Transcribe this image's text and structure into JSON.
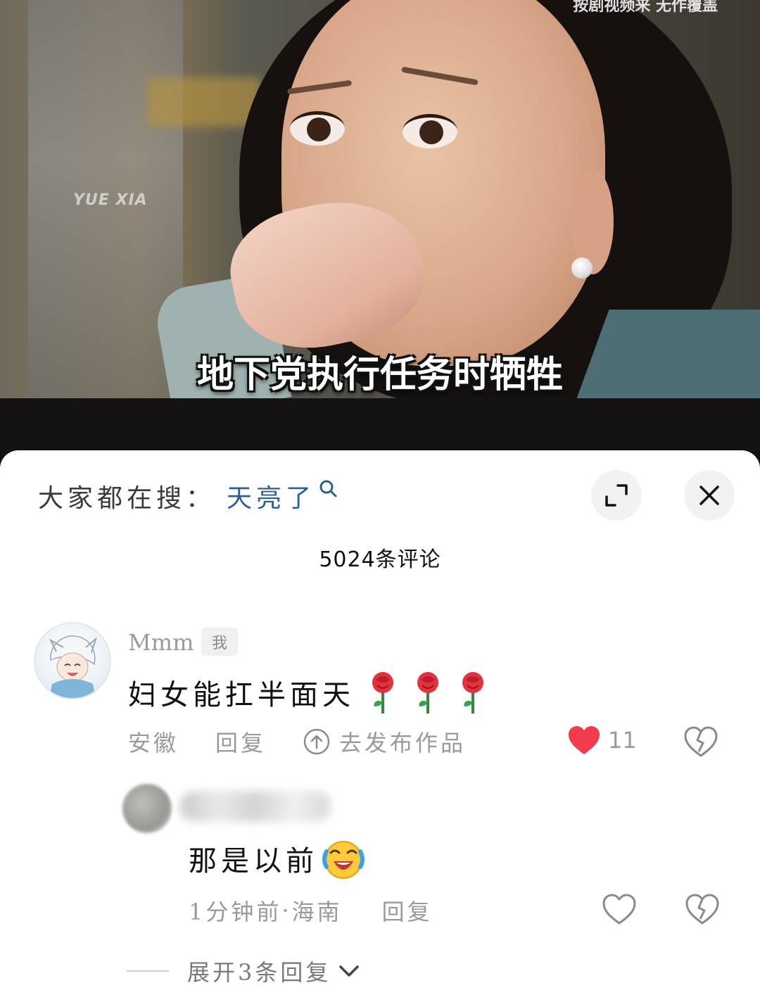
{
  "video": {
    "watermark": "YUE XIA",
    "top_caption": "按剧视频来 无作覆盖",
    "subtitle": "地下党执行任务时牺牲"
  },
  "panel": {
    "search_label": "大家都在搜：",
    "search_term": "天亮了",
    "comment_count": "5024条评论"
  },
  "comment": {
    "username": "Mmm",
    "me_tag": "我",
    "text": "妇女能扛半面天",
    "location": "安徽",
    "reply_label": "回复",
    "publish_label": "去发布作品",
    "likes": "11",
    "liked": true
  },
  "reply": {
    "text": "那是以前",
    "time": "1分钟前",
    "separator": "·",
    "location": "海南",
    "reply_label": "回复",
    "expand_label": "展开3条回复"
  },
  "colors": {
    "accent_search": "#2d5f96",
    "like_red": "#f23b4d",
    "muted_text": "#9a9a9a"
  }
}
